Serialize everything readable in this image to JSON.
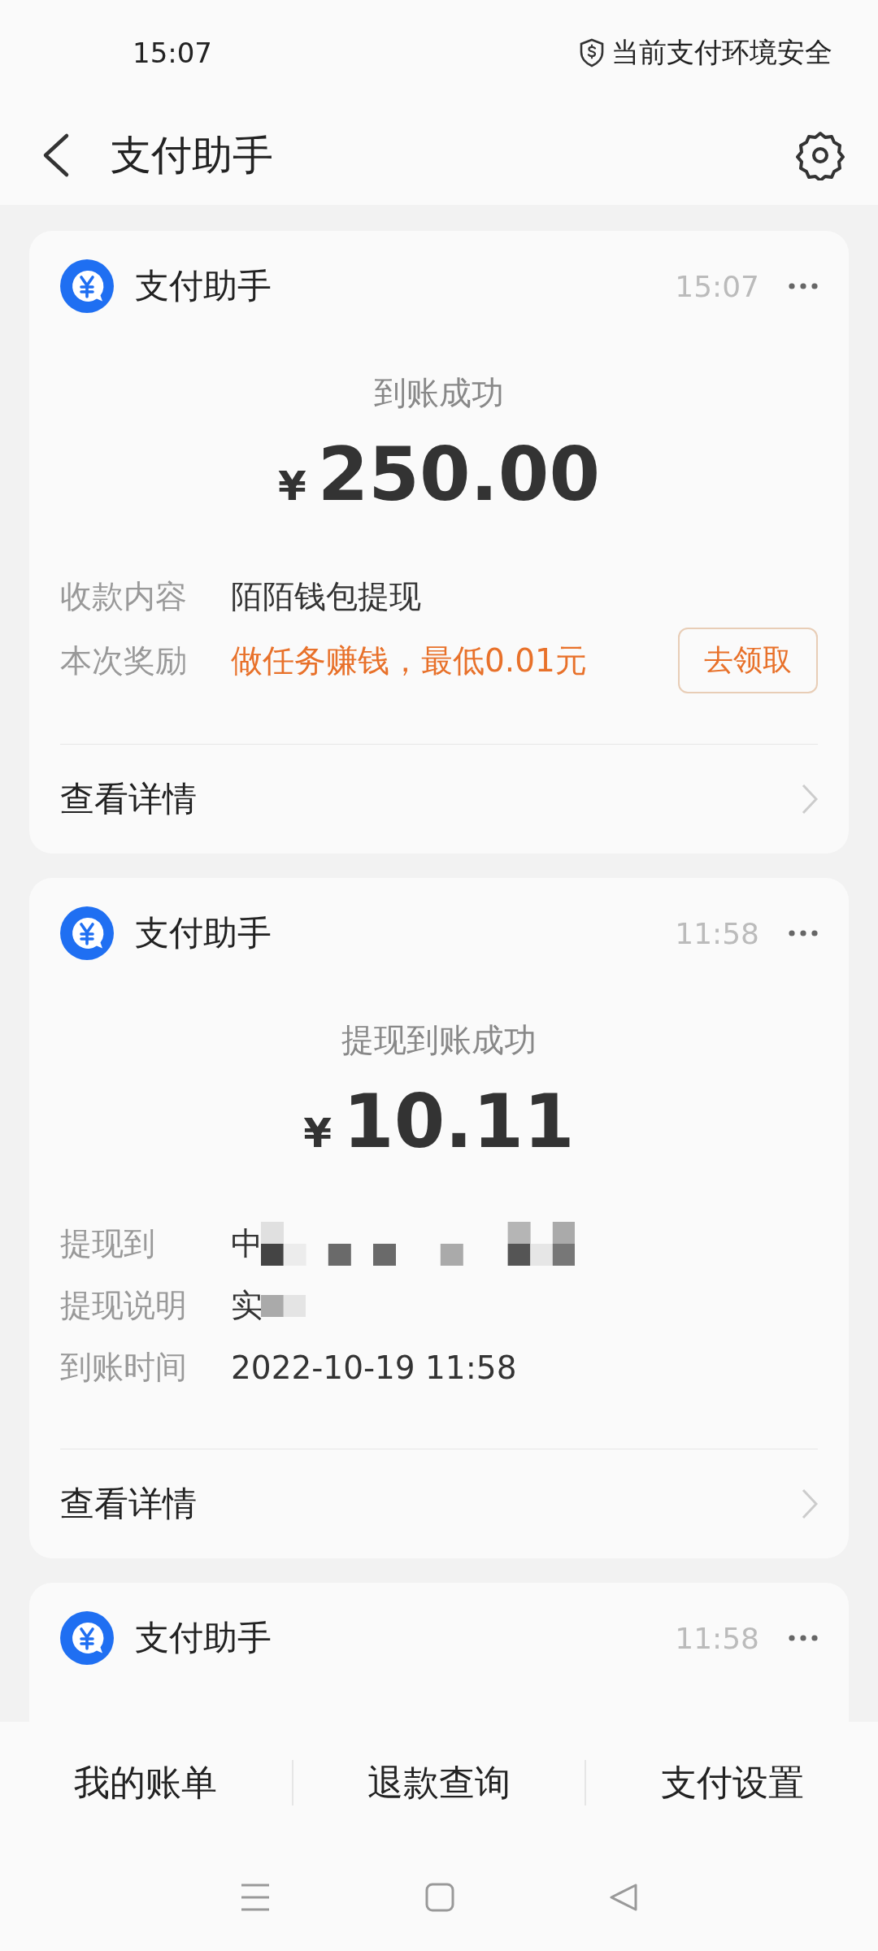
{
  "status_bar": {
    "time": "15:07",
    "security": "当前支付环境安全"
  },
  "header": {
    "title": "支付助手"
  },
  "messages": [
    {
      "sender": "支付助手",
      "time": "15:07",
      "headline": "到账成功",
      "currency": "¥",
      "amount": "250.00",
      "rows": [
        {
          "label": "收款内容",
          "value": "陌陌钱包提现",
          "kind": "text"
        },
        {
          "label": "本次奖励",
          "value": "做任务赚钱，最低0.01元",
          "kind": "promo",
          "action": "去领取"
        }
      ],
      "details": "查看详情"
    },
    {
      "sender": "支付助手",
      "time": "11:58",
      "headline": "提现到账成功",
      "currency": "¥",
      "amount": "10.11",
      "rows": [
        {
          "label": "提现到",
          "value": "中",
          "kind": "masked"
        },
        {
          "label": "提现说明",
          "value": "实",
          "kind": "masked"
        },
        {
          "label": "到账时间",
          "value": "2022-10-19 11:58",
          "kind": "text"
        }
      ],
      "details": "查看详情"
    },
    {
      "sender": "支付助手",
      "time": "11:58"
    }
  ],
  "bottom_tabs": [
    "我的账单",
    "退款查询",
    "支付设置"
  ]
}
